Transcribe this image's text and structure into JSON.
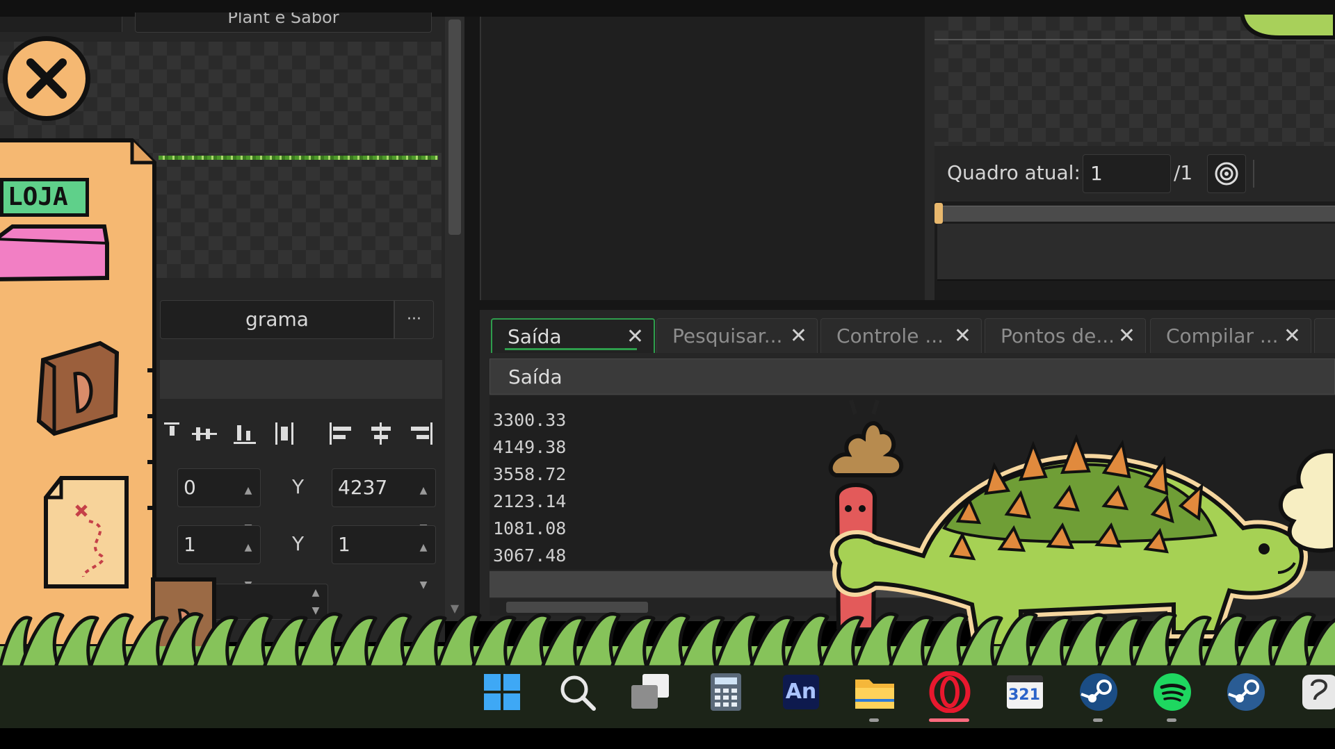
{
  "editor": {
    "top_field_text": "Plant e Sabor",
    "tileset_name": "grama",
    "more_button": "···",
    "position": {
      "x": "0",
      "y_label": "Y",
      "y": "4237"
    },
    "scale": {
      "x": "1",
      "y_label": "Y",
      "y": "1"
    }
  },
  "sprite_editor": {
    "frame_label": "Quadro atual:",
    "frame_value": "1",
    "frame_total": "/1"
  },
  "output_panel": {
    "tabs": [
      {
        "label": "Saída",
        "active": true
      },
      {
        "label": "Pesquisar...",
        "active": false
      },
      {
        "label": "Controle ...",
        "active": false
      },
      {
        "label": "Pontos de...",
        "active": false
      },
      {
        "label": "Compilar ...",
        "active": false
      }
    ],
    "header": "Saída",
    "lines": [
      "3300.33",
      "4149.38",
      "3558.72",
      "2123.14",
      "1081.08",
      "3067.48"
    ]
  },
  "game_overlay": {
    "shop_label": "LOJA"
  },
  "taskbar": {
    "icons": [
      "windows-start-icon",
      "search-icon",
      "task-view-icon",
      "calculator-icon",
      "animate-icon",
      "file-explorer-icon",
      "opera-icon",
      "media-player-icon",
      "steam-icon",
      "spotify-icon",
      "steam-icon-2",
      "cortana-icon"
    ],
    "animate_text": "An",
    "media_text": "321"
  },
  "colors": {
    "accent": "#2e9d4c",
    "panel": "#262626",
    "shop_paper": "#f5b872",
    "grass": "#86c35a"
  }
}
